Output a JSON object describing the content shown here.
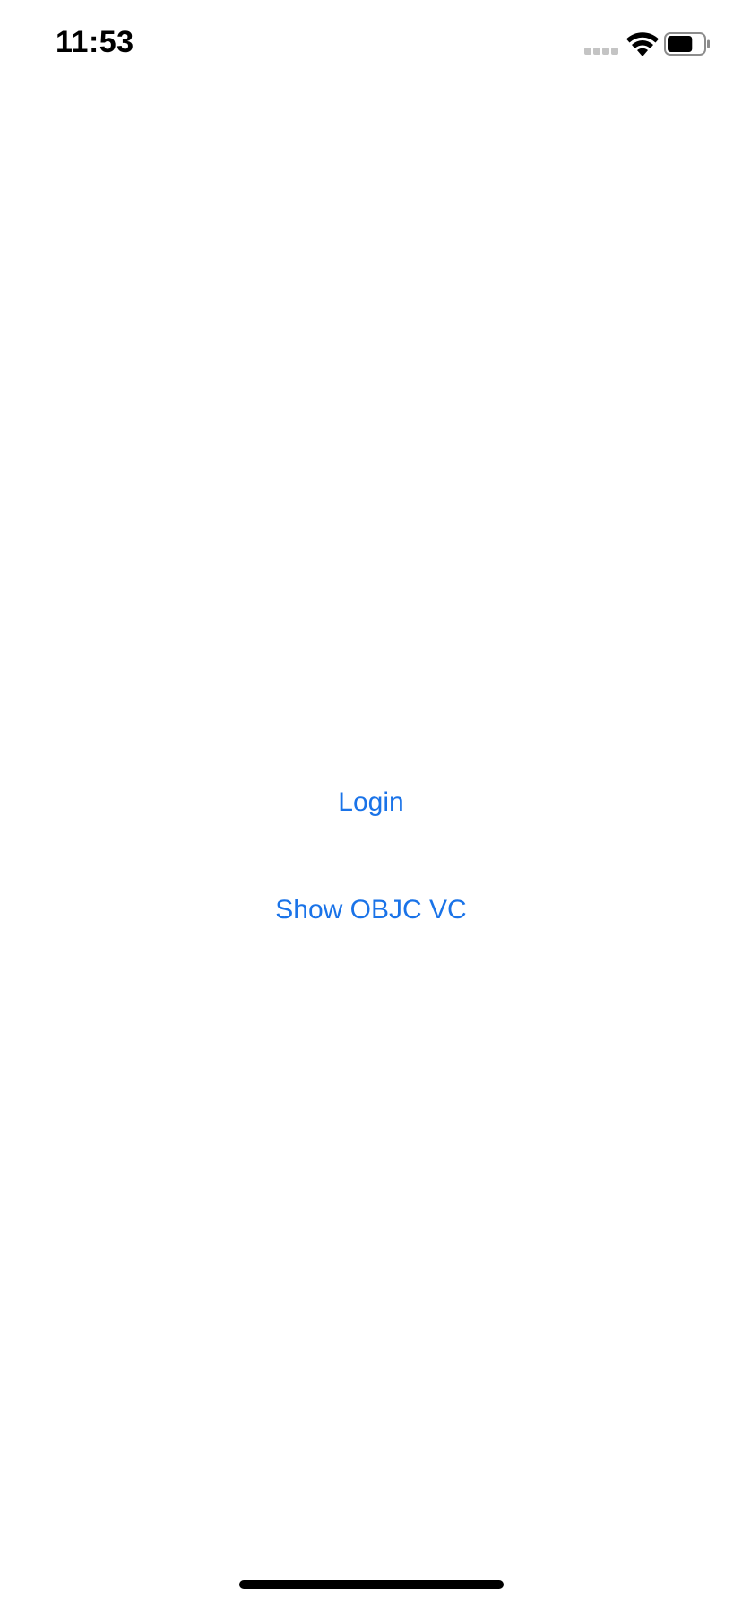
{
  "status_bar": {
    "time": "11:53",
    "signal_icon": "cellular-signal-icon",
    "wifi_icon": "wifi-icon",
    "battery_icon": "battery-icon",
    "battery_level": 0.7
  },
  "main": {
    "login_label": "Login",
    "show_objc_label": "Show OBJC VC"
  },
  "colors": {
    "tint": "#1a73e8",
    "background": "#ffffff",
    "text": "#000000"
  }
}
